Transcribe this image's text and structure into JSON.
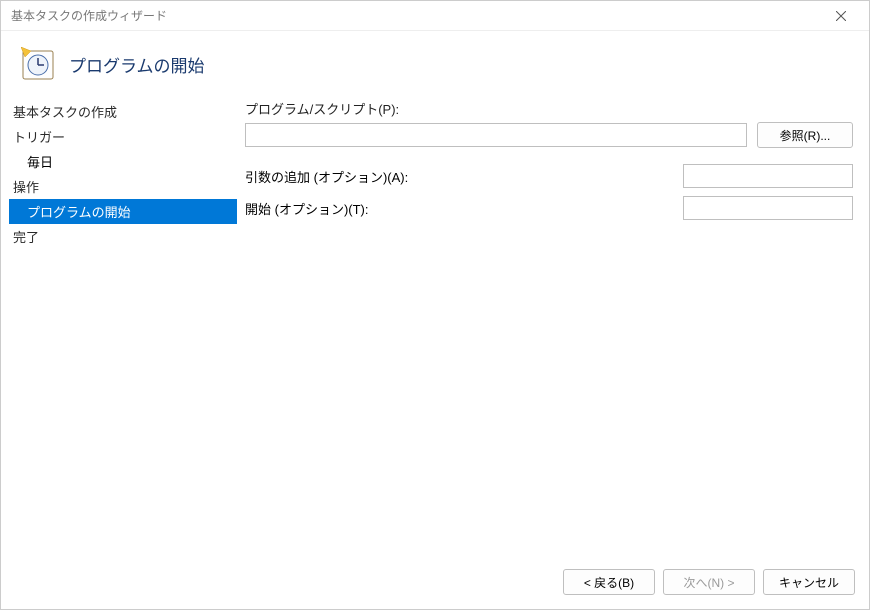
{
  "window": {
    "title": "基本タスクの作成ウィザード"
  },
  "header": {
    "page_title": "プログラムの開始"
  },
  "sidebar": {
    "items": [
      {
        "label": "基本タスクの作成",
        "indent": 0,
        "selected": false
      },
      {
        "label": "トリガー",
        "indent": 0,
        "selected": false
      },
      {
        "label": "毎日",
        "indent": 1,
        "selected": false
      },
      {
        "label": "操作",
        "indent": 0,
        "selected": false
      },
      {
        "label": "プログラムの開始",
        "indent": 1,
        "selected": true
      },
      {
        "label": "完了",
        "indent": 0,
        "selected": false
      }
    ]
  },
  "form": {
    "program_label": "プログラム/スクリプト(P):",
    "program_value": "",
    "browse_label": "参照(R)...",
    "args_label": "引数の追加 (オプション)(A):",
    "args_value": "",
    "startin_label": "開始 (オプション)(T):",
    "startin_value": ""
  },
  "footer": {
    "back": "< 戻る(B)",
    "next": "次へ(N) >",
    "cancel": "キャンセル"
  }
}
